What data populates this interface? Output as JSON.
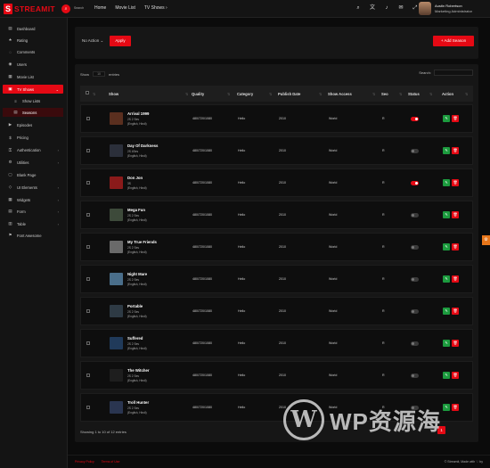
{
  "brand": {
    "logo_letter": "S",
    "name": "STREAMIT"
  },
  "topbar": {
    "search_label": "Search",
    "nav": [
      "Home",
      "Movie List",
      "TV Shows"
    ],
    "nav_chevron": "›",
    "user": {
      "name": "Austin Robertson",
      "role": "Marketing Administrator"
    }
  },
  "sidebar": {
    "items": [
      {
        "label": "Dashboard",
        "icon": "dashboard-icon",
        "glyph": "▤"
      },
      {
        "label": "Rating",
        "icon": "star-icon",
        "glyph": "★"
      },
      {
        "label": "Comments",
        "icon": "comment-icon",
        "glyph": "◌"
      },
      {
        "label": "Users",
        "icon": "user-icon",
        "glyph": "◉"
      },
      {
        "label": "Movie List",
        "icon": "film-icon",
        "glyph": "▦"
      },
      {
        "label": "TV Shows",
        "icon": "tv-icon",
        "glyph": "▣"
      },
      {
        "label": "Show Lists",
        "icon": "list-icon",
        "glyph": "≡"
      },
      {
        "label": "Seasons",
        "icon": "season-icon",
        "glyph": "▤"
      },
      {
        "label": "Episodes",
        "icon": "episode-icon",
        "glyph": "▶"
      },
      {
        "label": "Pricing",
        "icon": "price-icon",
        "glyph": "$"
      },
      {
        "label": "Authentication",
        "icon": "lock-icon",
        "glyph": "⚿"
      },
      {
        "label": "Utilities",
        "icon": "tool-icon",
        "glyph": "⚙"
      },
      {
        "label": "Blank Page",
        "icon": "page-icon",
        "glyph": "▢"
      },
      {
        "label": "UI Elements",
        "icon": "element-icon",
        "glyph": "◇"
      },
      {
        "label": "Widgets",
        "icon": "widget-icon",
        "glyph": "▦"
      },
      {
        "label": "Form",
        "icon": "form-icon",
        "glyph": "▤"
      },
      {
        "label": "Table",
        "icon": "table-icon",
        "glyph": "▥"
      },
      {
        "label": "Font Awesome",
        "icon": "flag-icon",
        "glyph": "⚑"
      }
    ]
  },
  "toolbar": {
    "bulk_select": "No Action",
    "apply": "Apply",
    "add": "+ Add Season"
  },
  "table": {
    "show_label": "Show",
    "entries_label": "entries",
    "entries_value": "10",
    "search_label": "Search:",
    "headers": [
      "Show",
      "Quality",
      "Category",
      "Publish Date",
      "Show Access",
      "Seo",
      "Status",
      "Action"
    ],
    "sort_glyph": "⇅",
    "rows": [
      {
        "title": "Arrival 1999",
        "seasons": "2S 2 Ses",
        "langs": "(English, Hindi)",
        "quality": "480/720/1080",
        "category": "Hello",
        "date": "2010",
        "access": "World",
        "seo": "R",
        "status_on": true,
        "thumb": "#5a2f1f"
      },
      {
        "title": "Day Of Darkness",
        "seasons": "2S 4Ses",
        "langs": "(English, Hindi)",
        "quality": "480/720/1080",
        "category": "Hello",
        "date": "2010",
        "access": "World",
        "seo": "R",
        "status_on": false,
        "thumb": "#2b2f3a"
      },
      {
        "title": "Don Jon",
        "seasons": "3S",
        "langs": "(English, Hindi)",
        "quality": "480/720/1080",
        "category": "Hello",
        "date": "2010",
        "access": "World",
        "seo": "R",
        "status_on": true,
        "thumb": "#8a1a1a"
      },
      {
        "title": "Mega Fun",
        "seasons": "2S 2 Ses",
        "langs": "(English, Hindi)",
        "quality": "480/720/1080",
        "category": "Hello",
        "date": "2010",
        "access": "World",
        "seo": "R",
        "status_on": false,
        "thumb": "#3d4a3a"
      },
      {
        "title": "My True Friends",
        "seasons": "2S 2 Ses",
        "langs": "(English, Hindi)",
        "quality": "480/720/1080",
        "category": "Hello",
        "date": "2010",
        "access": "World",
        "seo": "R",
        "status_on": false,
        "thumb": "#6a6a6a"
      },
      {
        "title": "Night Mare",
        "seasons": "2S 2 Ses",
        "langs": "(English, Hindi)",
        "quality": "480/720/1080",
        "category": "Hello",
        "date": "2010",
        "access": "World",
        "seo": "R",
        "status_on": false,
        "thumb": "#4a6e8a"
      },
      {
        "title": "Portable",
        "seasons": "2S 2 Ses",
        "langs": "(English, Hindi)",
        "quality": "480/720/1080",
        "category": "Hello",
        "date": "2010",
        "access": "World",
        "seo": "R",
        "status_on": false,
        "thumb": "#2e3a44"
      },
      {
        "title": "Suffered",
        "seasons": "2S 2 Ses",
        "langs": "(English, Hindi)",
        "quality": "480/720/1080",
        "category": "Hello",
        "date": "2010",
        "access": "World",
        "seo": "R",
        "status_on": false,
        "thumb": "#203a5a"
      },
      {
        "title": "The Witcher",
        "seasons": "2S 2 Ses",
        "langs": "(English, Hindi)",
        "quality": "480/720/1080",
        "category": "Hello",
        "date": "2010",
        "access": "World",
        "seo": "R",
        "status_on": false,
        "thumb": "#1e1e1e"
      },
      {
        "title": "Troll Hunter",
        "seasons": "2S 2 Ses",
        "langs": "(English, Hindi)",
        "quality": "480/720/1080",
        "category": "Hello",
        "date": "2010",
        "access": "World",
        "seo": "R",
        "status_on": false,
        "thumb": "#2a3550"
      }
    ],
    "summary": "Showing 1 to 10 of 12 entries",
    "page_current": "1"
  },
  "footer": {
    "links": [
      "Privacy Policy",
      "Terms of Use"
    ],
    "copyright": "© Streamit, Made with ♡ by"
  },
  "watermark": {
    "mark": "W",
    "text": "WP资源海"
  },
  "colors": {
    "accent": "#e50914",
    "edit": "#1c9b3e",
    "bg": "#0b0b0b",
    "panel": "#161616"
  }
}
